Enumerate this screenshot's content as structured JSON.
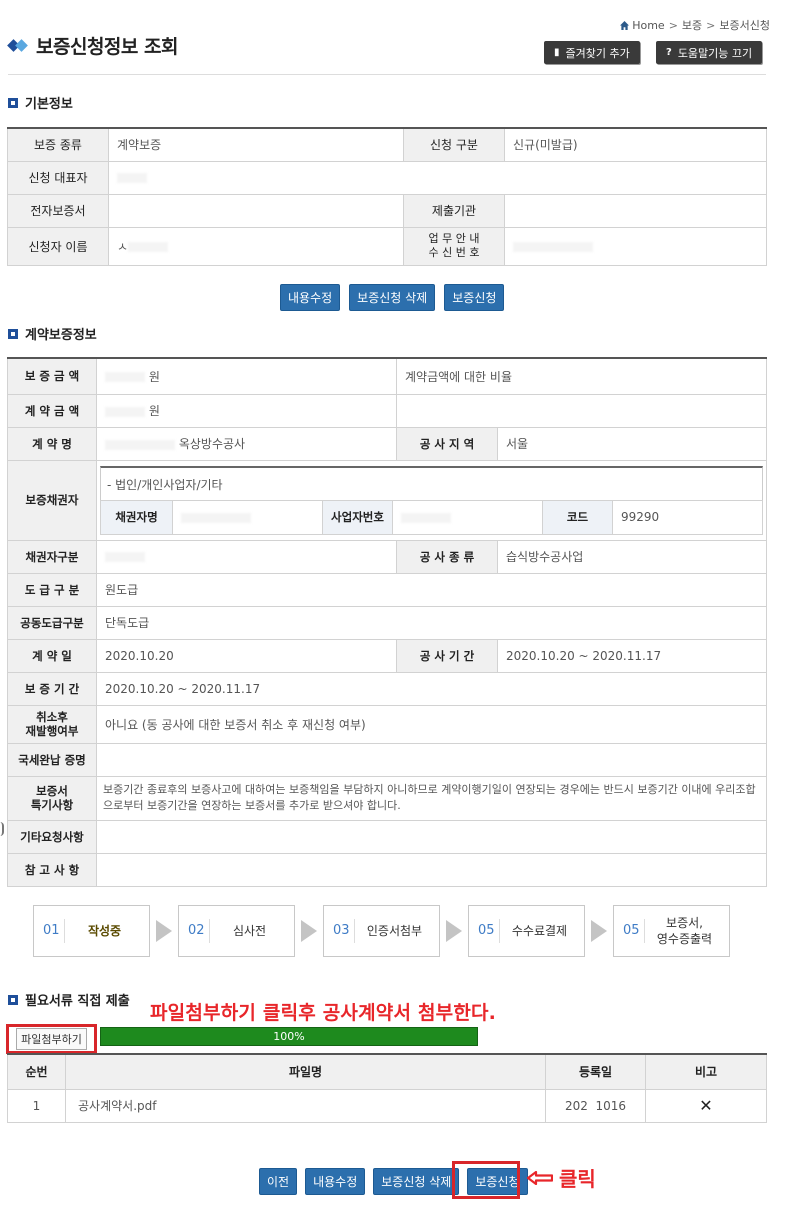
{
  "breadcrumb": {
    "home": "Home",
    "level1": "보증",
    "level2": "보증서신청"
  },
  "header": {
    "title": "보증신청정보 조회",
    "bookmark_label": "즐겨찾기 추가",
    "help_label": "도움말기능 끄기",
    "help_icon_text": "?"
  },
  "basic": {
    "section_title": "기본정보",
    "rows": [
      {
        "label": "보증 종류",
        "value": "계약보증",
        "label2": "신청 구분",
        "value2": "신규(미발급)"
      },
      {
        "label": "신청 대표자",
        "value": ""
      },
      {
        "label": "전자보증서",
        "value": "",
        "label2": "제출기관",
        "value2": ""
      },
      {
        "label": "신청자 이름",
        "value": "ㅅ",
        "label2": "업 무 안 내\n수 신 번 호",
        "value2": ""
      }
    ],
    "buttons": [
      "내용수정",
      "보증신청 삭제",
      "보증신청"
    ]
  },
  "contract": {
    "section_title": "계약보증정보",
    "guarantee_amount_label": "보 증 금 액",
    "guarantee_amount_value": "원",
    "ratio_text": "계약금액에 대한 비율",
    "contract_amount_label": "계 약 금 액",
    "contract_amount_value": "원",
    "contract_name_label": "계 약 명",
    "contract_name_value": "옥상방수공사",
    "region_label": "공 사 지 역",
    "region_value": "서울",
    "creditor_label": "보증채권자",
    "creditor_type": "- 법인/개인사업자/기타",
    "creditor_name_label": "채권자명",
    "biz_no_label": "사업자번호",
    "code_label": "코드",
    "code_value": "99290",
    "creditor_class_label": "채권자구분",
    "work_type_label": "공 사 종 류",
    "work_type_value": "습식방수공사업",
    "subcontract_label": "도 급 구 분",
    "subcontract_value": "원도급",
    "joint_label": "공동도급구분",
    "joint_value": "단독도급",
    "contract_date_label": "계 약 일",
    "contract_date_value": "2020.10.20",
    "period_label": "공 사 기 간",
    "period_value": "2020.10.20 ~ 2020.11.17",
    "guarantee_period_label": "보 증 기 간",
    "guarantee_period_value": "2020.10.20 ~ 2020.11.17",
    "reissue_label": "취소후\n재발행여부",
    "reissue_value": "아니요 (동 공사에 대한 보증서 취소 후 재신청 여부)",
    "tax_label": "국세완납 증명",
    "special_label": "보증서\n특기사항",
    "special_value": "보증기간 종료후의 보증사고에 대하여는 보증책임을 부담하지 아니하므로 계약이행기일이 연장되는 경우에는 반드시 보증기간 이내에 우리조합으로부터 보증기간을 연장하는 보증서를 추가로 받으셔야 합니다.",
    "other_label": "기타요청사항",
    "note_label": "참 고 사 항"
  },
  "steps": [
    {
      "num": "01",
      "label": "작성중"
    },
    {
      "num": "02",
      "label": "심사전"
    },
    {
      "num": "03",
      "label": "인증서첨부"
    },
    {
      "num": "05",
      "label": "수수료결제"
    },
    {
      "num": "05",
      "label": "보증서,\n영수증출력"
    }
  ],
  "docs": {
    "section_title": "필요서류 직접 제출",
    "annotation": "파일첨부하기 클릭후 공사계약서 첨부한다.",
    "upload_label": "파일첨부하기",
    "progress_text": "100%",
    "progress_value": 1.0,
    "columns": [
      "순번",
      "파일명",
      "등록일",
      "비고"
    ],
    "rows": [
      {
        "no": "1",
        "name": "공사계약서.pdf",
        "date": "202  1016",
        "remark": "✕"
      }
    ]
  },
  "bottom_buttons": [
    "이전",
    "내용수정",
    "보증신청 삭제",
    "보증신청"
  ],
  "click_annotation": "클릭",
  "colors": {
    "button": "#2c6fad",
    "annotation": "#e8262a",
    "progress": "#1e8a1e"
  }
}
